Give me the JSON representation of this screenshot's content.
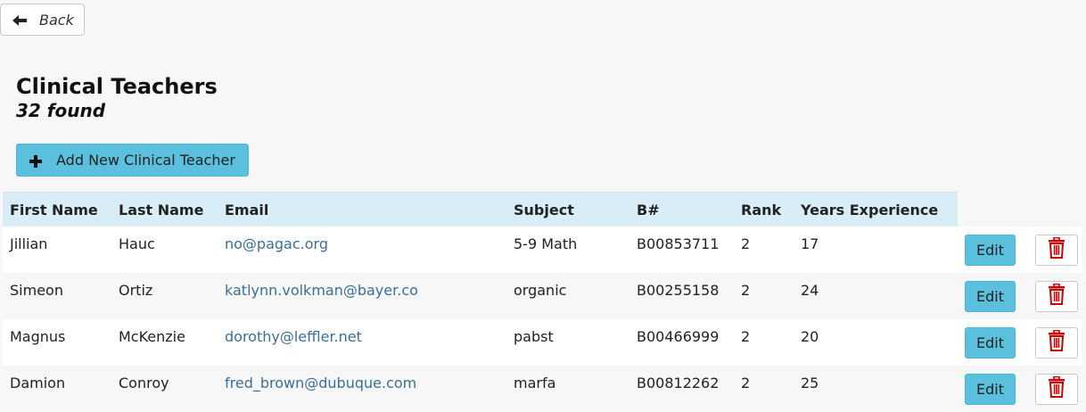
{
  "nav": {
    "back_label": "Back"
  },
  "header": {
    "title": "Clinical Teachers",
    "found": "32 found"
  },
  "actions": {
    "add_label": "Add New Clinical Teacher"
  },
  "table": {
    "columns": [
      "First Name",
      "Last Name",
      "Email",
      "Subject",
      "B#",
      "Rank",
      "Years Experience"
    ],
    "rows": [
      {
        "first": "Jillian",
        "last": "Hauc",
        "email": "no@pagac.org",
        "subject": "5-9 Math",
        "bnum": "B00853711",
        "rank": "2",
        "years": "17"
      },
      {
        "first": "Simeon",
        "last": "Ortiz",
        "email": "katlynn.volkman@bayer.co",
        "subject": "organic",
        "bnum": "B00255158",
        "rank": "2",
        "years": "24"
      },
      {
        "first": "Magnus",
        "last": "McKenzie",
        "email": "dorothy@leffler.net",
        "subject": "pabst",
        "bnum": "B00466999",
        "rank": "2",
        "years": "20"
      },
      {
        "first": "Damion",
        "last": "Conroy",
        "email": "fred_brown@dubuque.com",
        "subject": "marfa",
        "bnum": "B00812262",
        "rank": "2",
        "years": "25"
      }
    ],
    "edit_label": "Edit"
  },
  "icons": {
    "back": "arrow-left-icon",
    "add": "plus-icon",
    "delete": "trash-icon"
  },
  "colors": {
    "accent": "#5bc0de",
    "header_bg": "#d9edf7",
    "link": "#3a6f9a",
    "danger": "#cc0000"
  }
}
